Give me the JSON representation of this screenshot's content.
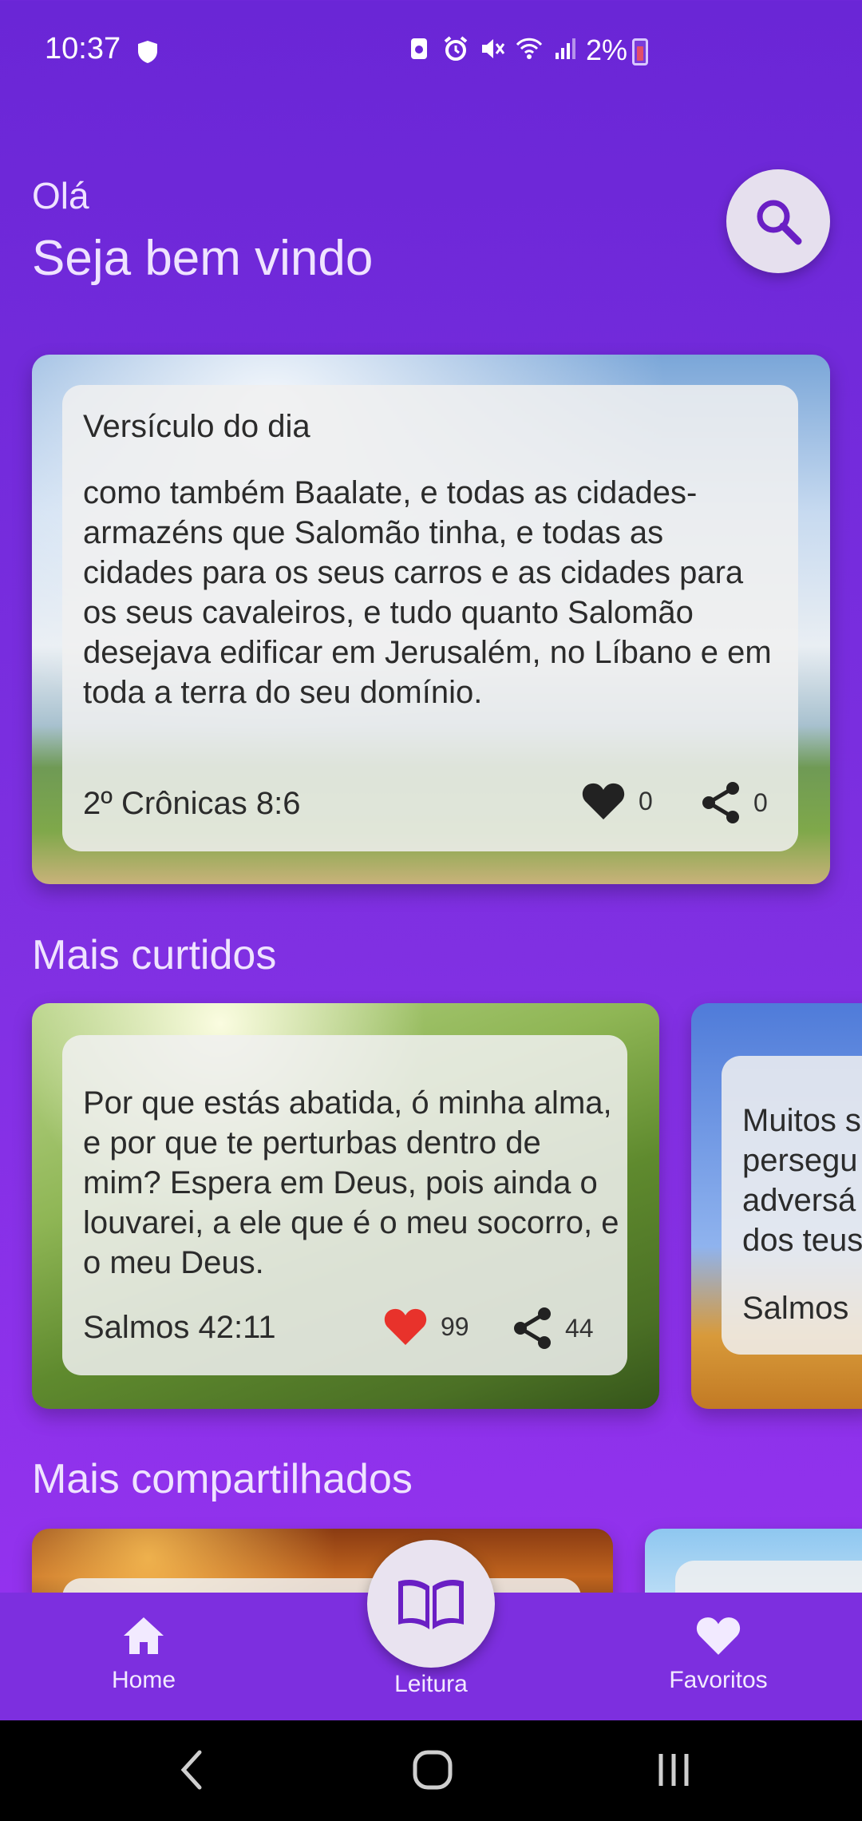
{
  "status_bar": {
    "time": "10:37",
    "battery": "2%",
    "icons": [
      "shield-icon",
      "recycle-icon",
      "alarm-icon",
      "mute-icon",
      "wifi-icon",
      "signal-icon",
      "battery-icon"
    ]
  },
  "header": {
    "greeting": "Olá",
    "welcome": "Seja bem vindo",
    "search_icon": "search-icon"
  },
  "verse_of_day": {
    "title": "Versículo do dia",
    "text": "como também Baalate, e todas as cidades-armazéns que Salomão tinha, e todas as cidades para os seus carros e as cidades para os seus cavaleiros, e tudo quanto Salomão desejava edificar em Jerusalém, no Líbano e em toda a terra do seu domínio.",
    "reference": "2º Crônicas 8:6",
    "likes": "0",
    "shares": "0"
  },
  "most_liked": {
    "section_title": "Mais curtidos",
    "cards": [
      {
        "text": "Por que estás abatida, ó minha alma, e por que te perturbas dentro de mim? Espera em Deus, pois ainda o louvarei, a ele que é o meu socorro, e o meu Deus.",
        "reference": "Salmos 42:11",
        "likes": "99",
        "shares": "44",
        "liked_color": "#e8322b"
      },
      {
        "text_lines": [
          "Muitos s",
          "persegu",
          "adversá",
          "dos teus"
        ],
        "reference": "Salmos"
      }
    ]
  },
  "most_shared": {
    "section_title": "Mais compartilhados"
  },
  "bottom_nav": {
    "home": "Home",
    "reading": "Leitura",
    "favorites": "Favoritos"
  },
  "colors": {
    "background_top": "#6a26d6",
    "background_bottom": "#9a33f2",
    "nav": "#7d2fdf"
  }
}
